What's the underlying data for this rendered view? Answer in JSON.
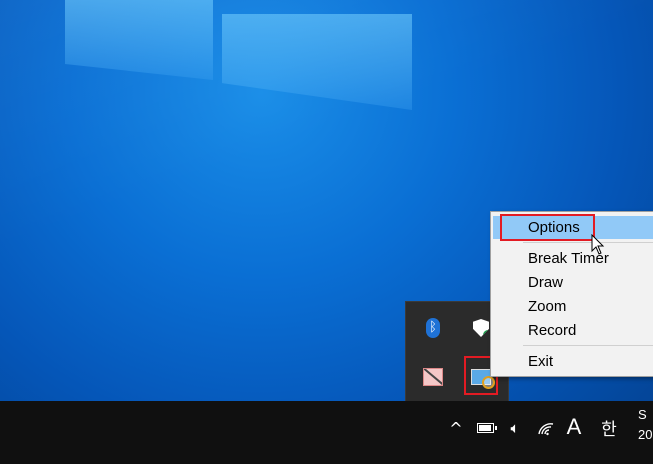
{
  "context_menu": {
    "items": [
      {
        "label": "Options",
        "selected": true
      },
      {
        "label": "Break Timer"
      },
      {
        "label": "Draw"
      },
      {
        "label": "Zoom"
      },
      {
        "label": "Record"
      },
      {
        "label": "Exit"
      }
    ]
  },
  "tray_overflow": {
    "icons": [
      "bluetooth-icon",
      "windows-security-icon",
      "draw-app-icon",
      "zoomit-icon"
    ]
  },
  "taskbar": {
    "show_hidden_icons": "^",
    "ime_mode": "A",
    "language": "한",
    "clock_line1": "S",
    "clock_line2": "20"
  },
  "colors": {
    "highlight_border": "#e31b23",
    "menu_selected": "#91c9f7",
    "taskbar": "#101010",
    "desktop": "#0a6fd4"
  }
}
